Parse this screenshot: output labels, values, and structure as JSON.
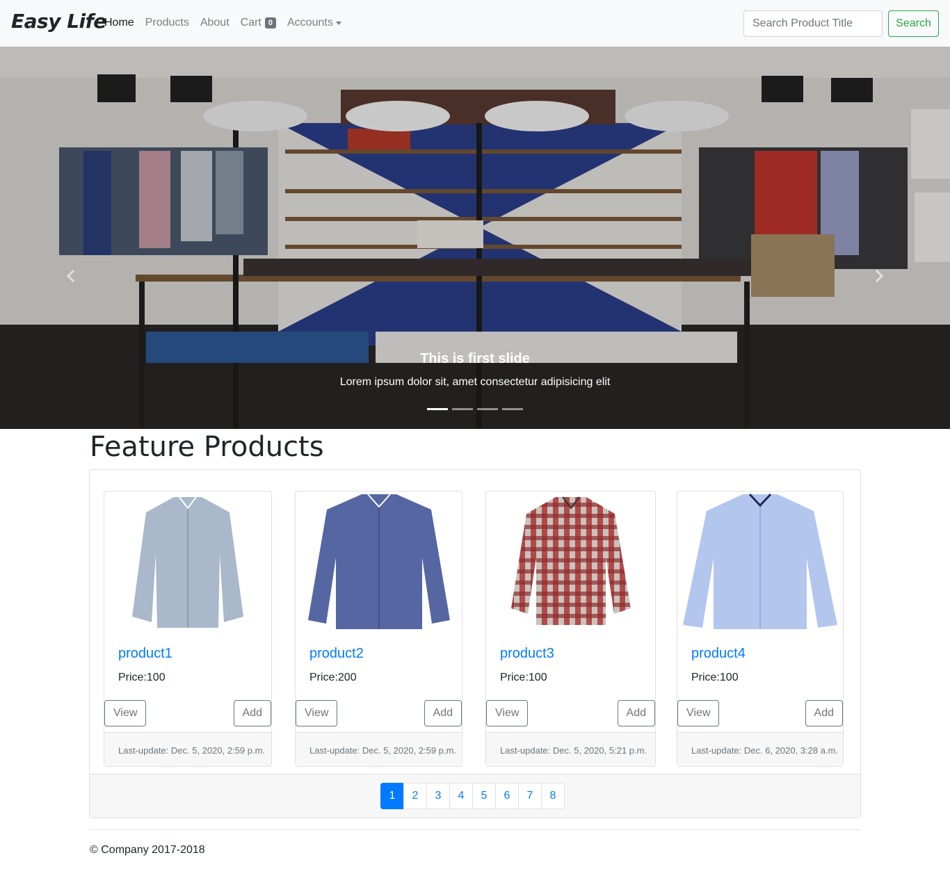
{
  "navbar": {
    "brand": "Easy Life",
    "links": {
      "home": "Home",
      "products": "Products",
      "about": "About",
      "cart": "Cart",
      "accounts": "Accounts"
    },
    "cart_count": "0",
    "search_placeholder": "Search Product Title",
    "search_label": "Search"
  },
  "carousel": {
    "caption_title": "This is first slide",
    "caption_text": "Lorem ipsum dolor sit, amet consectetur adipisicing elit",
    "slide_count": 4,
    "active_slide": 1
  },
  "main": {
    "title": "Feature Products",
    "products": [
      {
        "name": "product1",
        "price": "Price:100",
        "view_label": "View",
        "add_label": "Add",
        "updated": "Last-update: Dec. 5, 2020, 2:59 p.m.",
        "shirt_color": "#a9b8cb",
        "image": "light-grey-blue-shirt"
      },
      {
        "name": "product2",
        "price": "Price:200",
        "view_label": "View",
        "add_label": "Add",
        "updated": "Last-update: Dec. 5, 2020, 2:59 p.m.",
        "shirt_color": "#5566a3",
        "image": "blue-dress-shirt"
      },
      {
        "name": "product3",
        "price": "Price:100",
        "view_label": "View",
        "add_label": "Add",
        "updated": "Last-update: Dec. 5, 2020, 5:21 p.m.",
        "shirt_color": "#b24a4a",
        "image": "red-plaid-shirt"
      },
      {
        "name": "product4",
        "price": "Price:100",
        "view_label": "View",
        "add_label": "Add",
        "updated": "Last-update: Dec. 6, 2020, 3:28 a.m.",
        "shirt_color": "#b3c6ee",
        "image": "light-blue-shirt"
      }
    ],
    "pagination": {
      "pages": [
        "1",
        "2",
        "3",
        "4",
        "5",
        "6",
        "7",
        "8"
      ],
      "active": "1"
    }
  },
  "footer": {
    "copyright": "© Company 2017-2018"
  },
  "colors": {
    "primary": "#007bff",
    "success": "#28a745",
    "secondary": "#6c757d",
    "navbar_bg": "#f8f9fa"
  }
}
